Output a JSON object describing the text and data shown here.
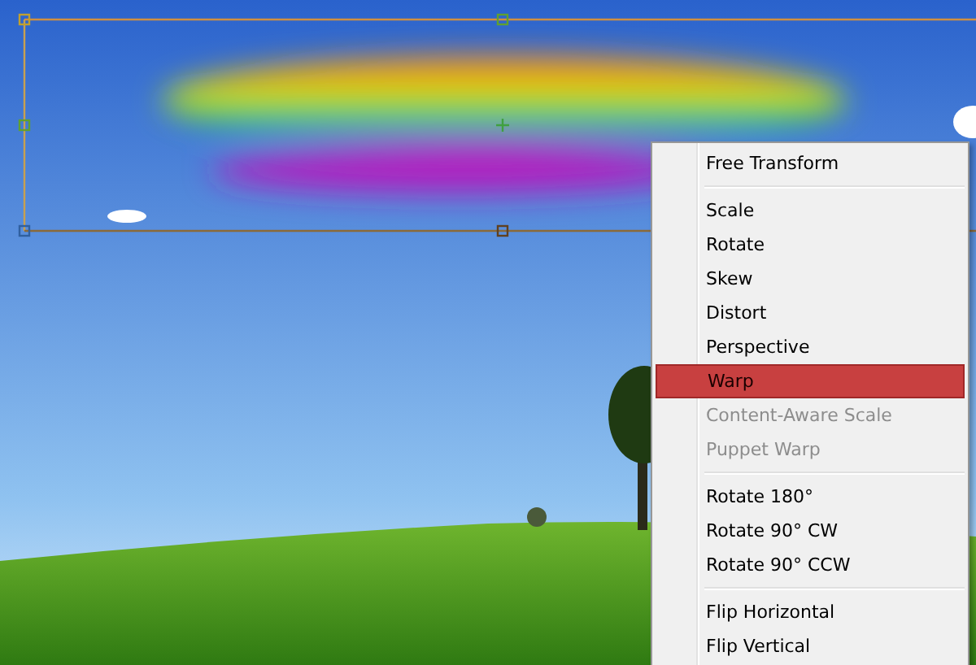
{
  "context_menu": {
    "groups": [
      {
        "items": [
          {
            "label": "Free Transform",
            "selected": false,
            "disabled": false
          }
        ]
      },
      {
        "items": [
          {
            "label": "Scale",
            "selected": false,
            "disabled": false
          },
          {
            "label": "Rotate",
            "selected": false,
            "disabled": false
          },
          {
            "label": "Skew",
            "selected": false,
            "disabled": false
          },
          {
            "label": "Distort",
            "selected": false,
            "disabled": false
          },
          {
            "label": "Perspective",
            "selected": false,
            "disabled": false
          },
          {
            "label": "Warp",
            "selected": true,
            "disabled": false
          },
          {
            "label": "Content-Aware Scale",
            "selected": false,
            "disabled": true
          },
          {
            "label": "Puppet Warp",
            "selected": false,
            "disabled": true
          }
        ]
      },
      {
        "items": [
          {
            "label": "Rotate 180°",
            "selected": false,
            "disabled": false
          },
          {
            "label": "Rotate 90° CW",
            "selected": false,
            "disabled": false
          },
          {
            "label": "Rotate 90° CCW",
            "selected": false,
            "disabled": false
          }
        ]
      },
      {
        "items": [
          {
            "label": "Flip Horizontal",
            "selected": false,
            "disabled": false
          },
          {
            "label": "Flip Vertical",
            "selected": false,
            "disabled": false
          }
        ]
      }
    ]
  }
}
